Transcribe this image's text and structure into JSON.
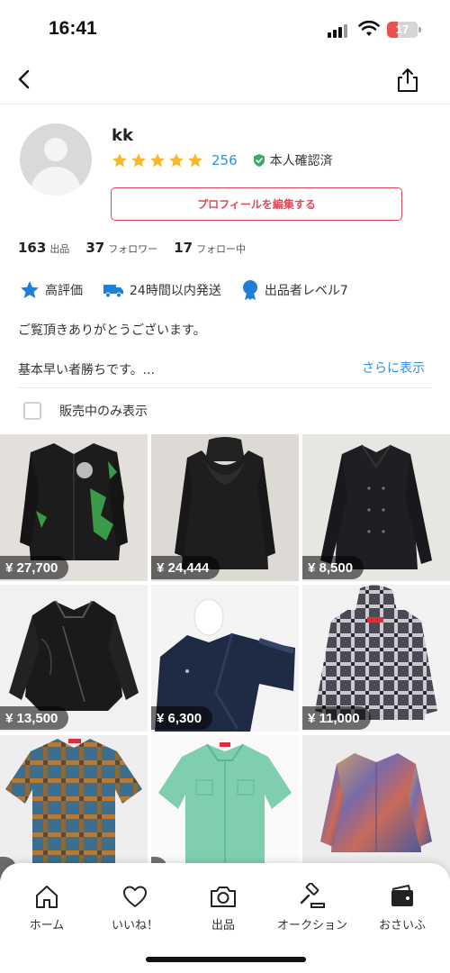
{
  "status_bar": {
    "time": "16:41",
    "battery": "17"
  },
  "nav": {
    "back_icon": "chevron-left-icon",
    "share_icon": "share-icon"
  },
  "profile": {
    "username": "kk",
    "stars": 5,
    "rating_count": "256",
    "verified_label": "本人確認済",
    "edit_button": "プロフィールを編集する"
  },
  "stats": [
    {
      "value": "163",
      "label": "出品"
    },
    {
      "value": "37",
      "label": "フォロワー"
    },
    {
      "value": "17",
      "label": "フォロー中"
    }
  ],
  "badges": [
    {
      "icon": "star-icon",
      "label": "高評価"
    },
    {
      "icon": "truck-icon",
      "label": "24時間以内発送"
    },
    {
      "icon": "medal-icon",
      "label": "出品者レベル7"
    }
  ],
  "bio": {
    "line1": "ご覧頂きありがとうございます。",
    "line2": "基本早い者勝ちです。...",
    "more": "さらに表示"
  },
  "filter": {
    "label": "販売中のみ表示",
    "checked": false
  },
  "items": [
    {
      "price": "¥ 27,700",
      "desc": "black knit cardigan"
    },
    {
      "price": "¥ 24,444",
      "desc": "black hooded jacket"
    },
    {
      "price": "¥ 8,500",
      "desc": "black double-breasted jacket"
    },
    {
      "price": "¥ 13,500",
      "desc": "black leather jacket"
    },
    {
      "price": "¥ 6,300",
      "desc": "navy denim rider jacket"
    },
    {
      "price": "¥ 11,000",
      "desc": "plaid hooded shirt"
    },
    {
      "price": "",
      "desc": "plaid short-sleeve shirt"
    },
    {
      "price": "",
      "desc": "mint short-sleeve shirt"
    },
    {
      "price": "",
      "desc": "tie-dye denim jacket"
    }
  ],
  "tabbar": [
    {
      "icon": "home-icon",
      "label": "ホーム"
    },
    {
      "icon": "heart-icon",
      "label": "いいね！"
    },
    {
      "icon": "camera-icon",
      "label": "出品"
    },
    {
      "icon": "gavel-icon",
      "label": "オークション"
    },
    {
      "icon": "wallet-icon",
      "label": "おさいふ"
    }
  ],
  "colors": {
    "accent_red": "#e0485a",
    "link_blue": "#2f8fd8",
    "star_yellow": "#f5b82e",
    "verified_green": "#3aaa6a"
  }
}
